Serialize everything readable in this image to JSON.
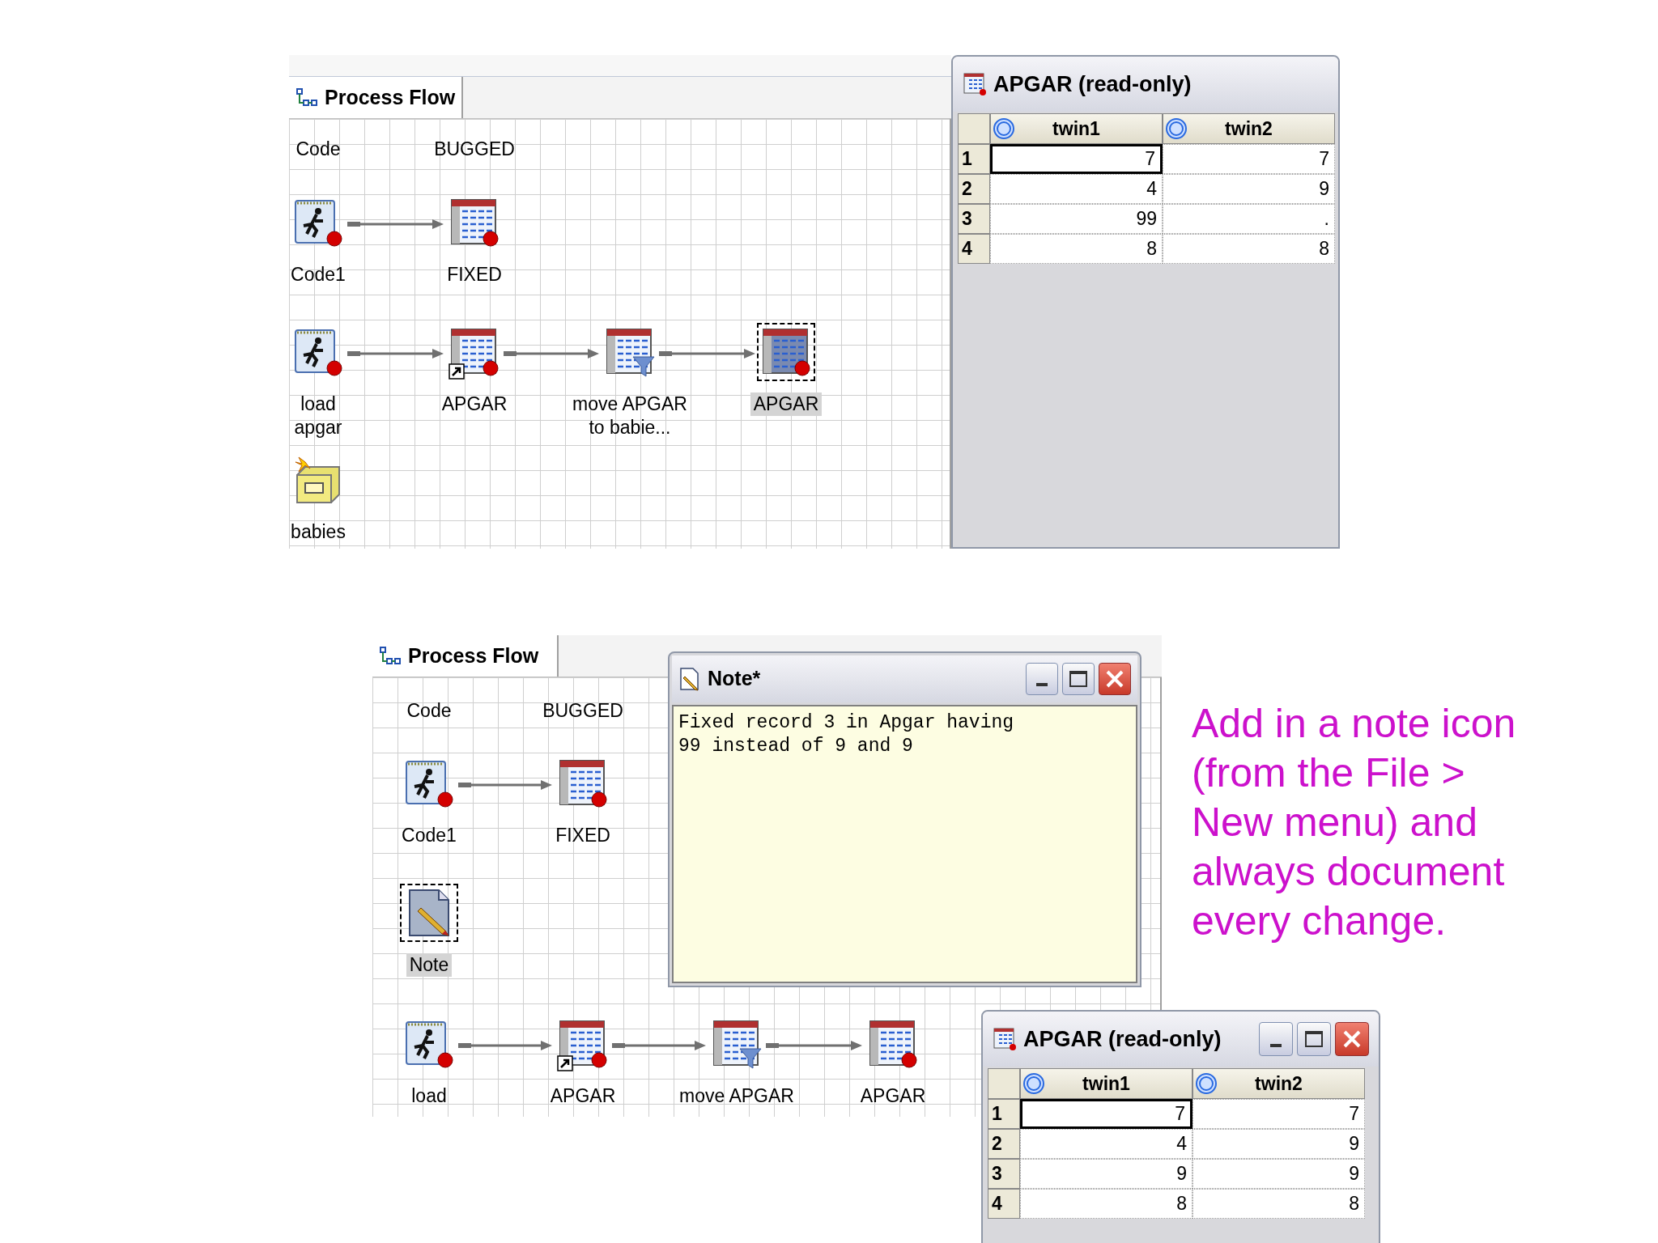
{
  "top_flow": {
    "tab": {
      "label": "Process Flow",
      "selected": true
    },
    "texts": [
      "Code",
      "BUGGED"
    ],
    "nodes": [
      {
        "kind": "code",
        "label": [
          "Code1"
        ],
        "selected": false,
        "shortcut": false
      },
      {
        "kind": "table",
        "label": [
          "FIXED"
        ],
        "selected": false,
        "shortcut": false
      },
      {
        "kind": "code",
        "label": [
          "load",
          "apgar"
        ],
        "selected": false,
        "shortcut": false
      },
      {
        "kind": "table",
        "label": [
          "APGAR"
        ],
        "selected": false,
        "shortcut": true
      },
      {
        "kind": "query",
        "label": [
          "move APGAR",
          "to babie..."
        ],
        "selected": false,
        "shortcut": false
      },
      {
        "kind": "table",
        "label": [
          "APGAR"
        ],
        "selected": true,
        "shortcut": false
      },
      {
        "kind": "library",
        "label": [
          "babies"
        ],
        "selected": false,
        "shortcut": false
      }
    ]
  },
  "top_table": {
    "title": "APGAR (read-only)",
    "columns": [
      "twin1",
      "twin2"
    ],
    "rows": [
      {
        "number": "1",
        "cells": [
          {
            "value": "7",
            "selected": true
          },
          {
            "value": "7",
            "selected": false
          }
        ]
      },
      {
        "number": "2",
        "cells": [
          {
            "value": "4",
            "selected": false
          },
          {
            "value": "9",
            "selected": false
          }
        ]
      },
      {
        "number": "3",
        "cells": [
          {
            "value": "99",
            "selected": false
          },
          {
            "value": ".",
            "selected": false
          }
        ]
      },
      {
        "number": "4",
        "cells": [
          {
            "value": "8",
            "selected": false
          },
          {
            "value": "8",
            "selected": false
          }
        ]
      }
    ]
  },
  "bottom_flow": {
    "tab": {
      "label": "Process Flow",
      "selected": true
    },
    "texts": [
      "Code",
      "BUGGED"
    ],
    "nodes": [
      {
        "kind": "code",
        "label": [
          "Code1"
        ],
        "selected": false,
        "shortcut": false
      },
      {
        "kind": "table",
        "label": [
          "FIXED"
        ],
        "selected": false,
        "shortcut": false
      },
      {
        "kind": "note",
        "label": [
          "Note"
        ],
        "selected": true,
        "shortcut": false
      },
      {
        "kind": "code",
        "label": [
          "load"
        ],
        "selected": false,
        "shortcut": false
      },
      {
        "kind": "table",
        "label": [
          "APGAR"
        ],
        "selected": false,
        "shortcut": true
      },
      {
        "kind": "query",
        "label": [
          "move APGAR"
        ],
        "selected": false,
        "shortcut": false
      },
      {
        "kind": "table",
        "label": [
          "APGAR"
        ],
        "selected": false,
        "shortcut": false
      }
    ]
  },
  "note_window": {
    "title": "Note*",
    "buttons": [
      {
        "kind": "minimize"
      },
      {
        "kind": "maximize"
      },
      {
        "kind": "close"
      }
    ],
    "lines": [
      "Fixed record 3 in Apgar having",
      "99 instead of 9 and 9"
    ]
  },
  "bottom_table": {
    "title": "APGAR (read-only)",
    "buttons": [
      {
        "kind": "minimize"
      },
      {
        "kind": "maximize"
      },
      {
        "kind": "close"
      }
    ],
    "columns": [
      "twin1",
      "twin2"
    ],
    "rows": [
      {
        "number": "1",
        "cells": [
          {
            "value": "7",
            "selected": true
          },
          {
            "value": "7",
            "selected": false
          }
        ]
      },
      {
        "number": "2",
        "cells": [
          {
            "value": "4",
            "selected": false
          },
          {
            "value": "9",
            "selected": false
          }
        ]
      },
      {
        "number": "3",
        "cells": [
          {
            "value": "9",
            "selected": false
          },
          {
            "value": "9",
            "selected": false
          }
        ]
      },
      {
        "number": "4",
        "cells": [
          {
            "value": "8",
            "selected": false
          },
          {
            "value": "8",
            "selected": false
          }
        ]
      }
    ]
  },
  "caption": [
    "Add in a note icon",
    "(from the File >",
    "New menu) and",
    "always document",
    "every change."
  ]
}
